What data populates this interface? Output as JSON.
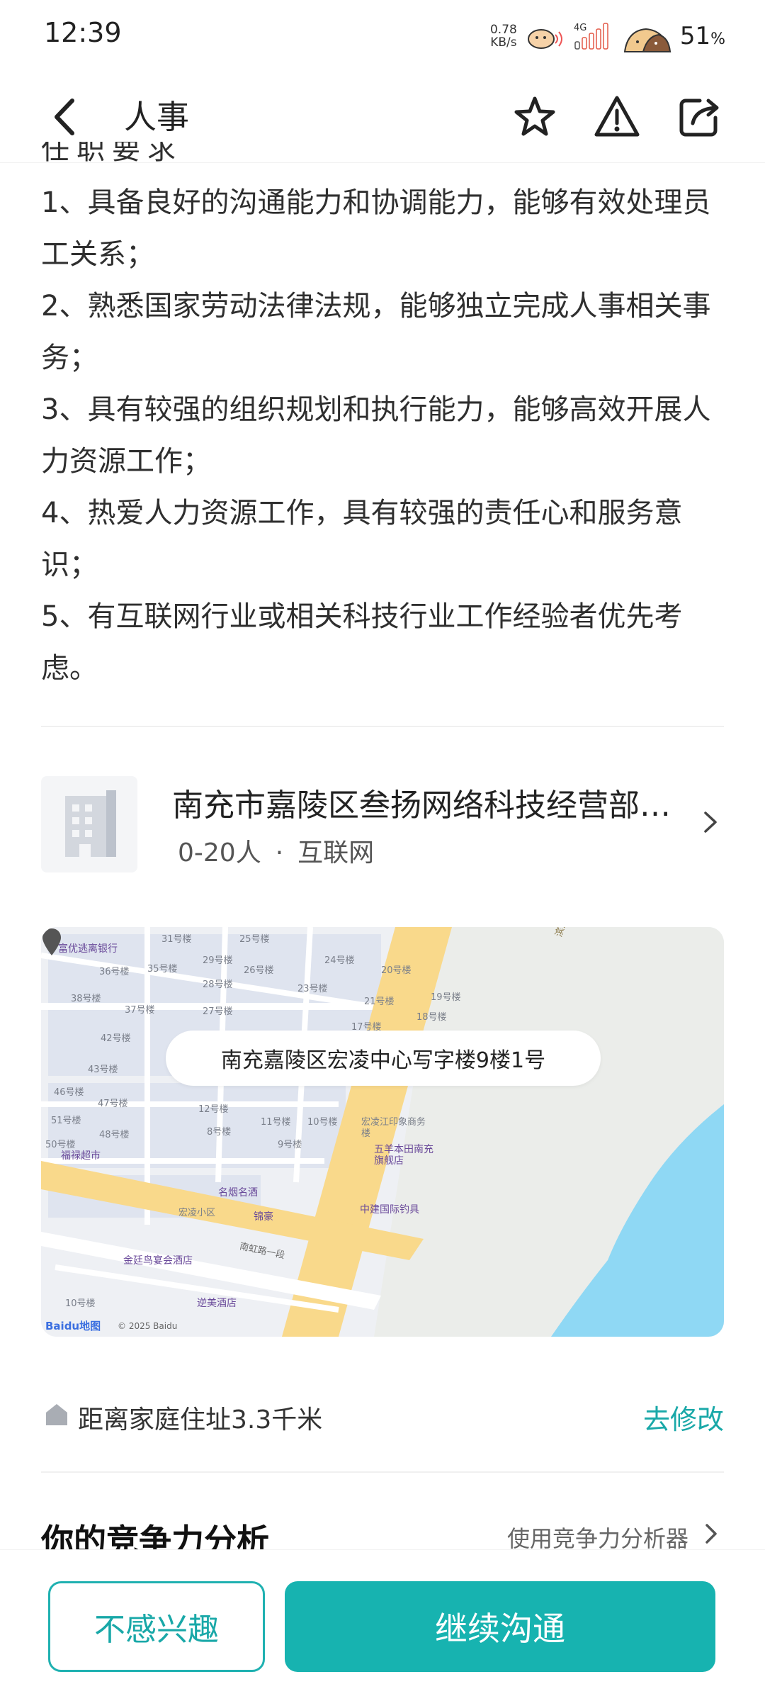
{
  "status_bar": {
    "time": "12:39",
    "net_speed_value": "0.78",
    "net_speed_unit": "KB/s",
    "network": "4G",
    "battery": "51",
    "battery_unit": "%"
  },
  "nav": {
    "title": "人事",
    "icons": [
      "back-icon",
      "star-icon",
      "warning-icon",
      "share-icon"
    ]
  },
  "requirements": {
    "cut_heading": "任职要求",
    "items": [
      "1、具备良好的沟通能力和协调能力，能够有效处理员工关系；",
      "2、熟悉国家劳动法律法规，能够独立完成人事相关事务；",
      "3、具有较强的组织规划和执行能力，能够高效开展人力资源工作；",
      "4、热爱人力资源工作，具有较强的责任心和服务意识；",
      "5、有互联网行业或相关科技行业工作经验者优先考虑。"
    ]
  },
  "company": {
    "name": "南充市嘉陵区叁扬网络科技经营部…",
    "size": "0-20人",
    "separator": "·",
    "industry": "互联网"
  },
  "map": {
    "address": "南充嘉陵区宏凌中心写字楼9楼1号",
    "baidu_logo": "Baidu地图",
    "copyright": "© 2025 Baidu",
    "labels": [
      "31号楼",
      "25号楼",
      "24号楼",
      "29号楼",
      "26号楼",
      "20号楼",
      "35号楼",
      "28号楼",
      "23号楼",
      "21号楼",
      "19号楼",
      "36号楼",
      "38号楼",
      "37号楼",
      "27号楼",
      "18号楼",
      "17号楼",
      "42号楼",
      "43号楼",
      "46号楼",
      "47号楼",
      "12号楼",
      "11号楼",
      "10号楼",
      "51号楼",
      "48号楼",
      "8号楼",
      "9号楼",
      "50号楼",
      "10号楼",
      "宏凌小区"
    ],
    "pois": [
      "福禄超市",
      "名烟名酒",
      "五羊本田南充旗舰店",
      "锦豪",
      "中建国际钓具",
      "金廷鸟宴会酒店",
      "逆美酒店",
      "富优逃离银行",
      "宏凌江印象商务楼"
    ],
    "roads": [
      "滨江大道滨江南路二段",
      "南虹路一段"
    ],
    "colors": {
      "water": "#8fd8f4",
      "main_road": "#f9d98b",
      "block": "#dde3ef",
      "green": "#e8ebe7"
    }
  },
  "distance": {
    "text": "距离家庭住址3.3千米",
    "action": "去修改"
  },
  "competitiveness": {
    "title": "你的竞争力分析",
    "link": "使用竞争力分析器"
  },
  "actions": {
    "not_interested": "不感兴趣",
    "continue_chat": "继续沟通"
  },
  "colors": {
    "accent": "#17b3b0"
  }
}
